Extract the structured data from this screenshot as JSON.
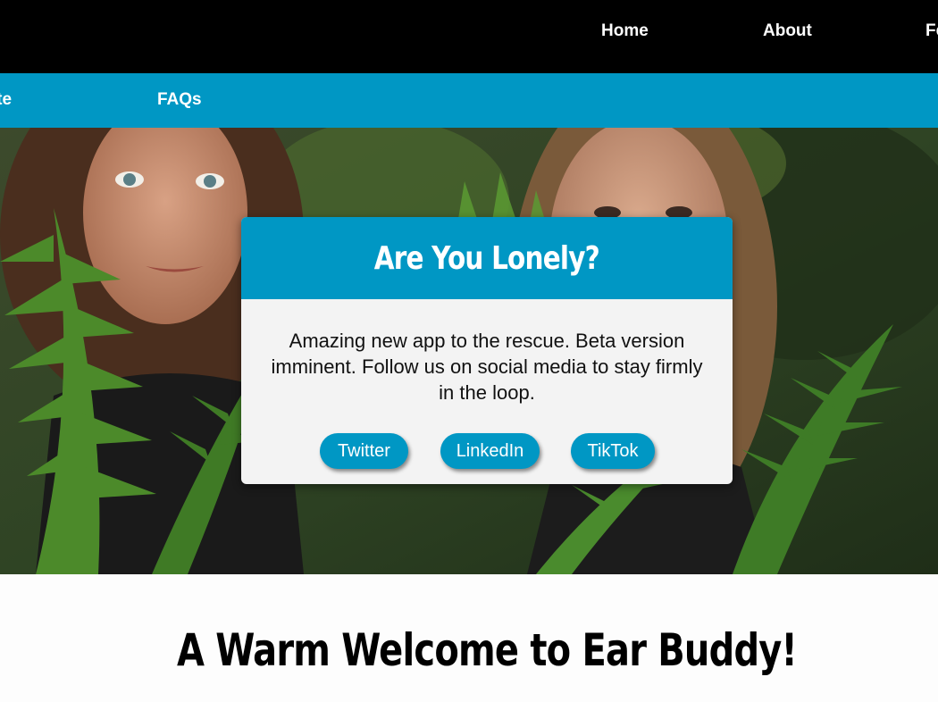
{
  "nav_top": {
    "items": [
      {
        "label": "Home"
      },
      {
        "label": "About"
      },
      {
        "label": "Fe"
      }
    ]
  },
  "nav_sub": {
    "items": [
      {
        "label": "nate"
      },
      {
        "label": "FAQs"
      }
    ]
  },
  "modal": {
    "title": "Are You Lonely?",
    "body": "Amazing new app to the rescue. Beta version imminent. Follow us on social media to stay firmly in the loop.",
    "buttons": [
      {
        "label": "Twitter"
      },
      {
        "label": "LinkedIn"
      },
      {
        "label": "TikTok"
      }
    ]
  },
  "welcome": {
    "title": "A Warm Welcome to Ear Buddy!"
  },
  "colors": {
    "accent": "#0097c4",
    "topbar": "#000000",
    "modal_bg": "#f3f3f3"
  }
}
